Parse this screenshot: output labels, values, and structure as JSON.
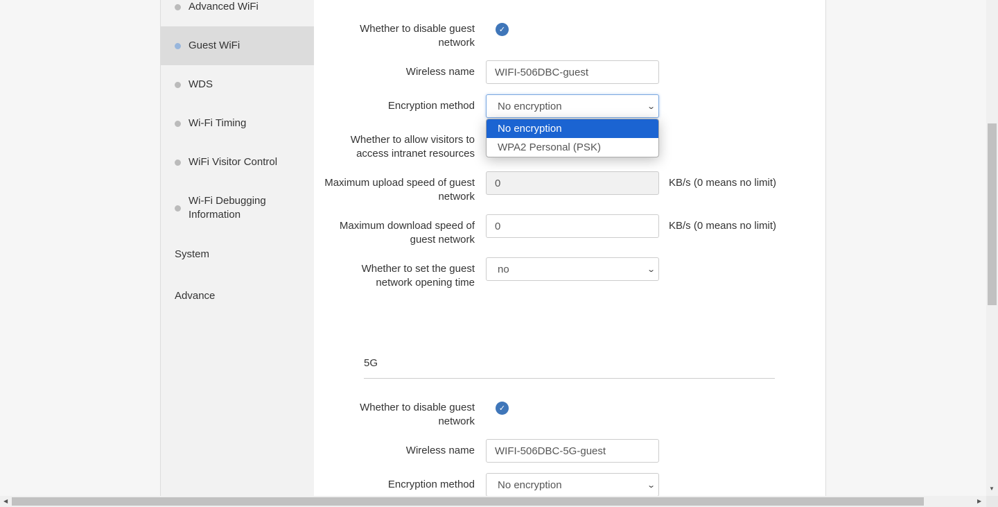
{
  "sidebar": {
    "items": [
      {
        "label": "Advanced WiFi",
        "active": false
      },
      {
        "label": "Guest WiFi",
        "active": true
      },
      {
        "label": "WDS",
        "active": false
      },
      {
        "label": "Wi-Fi Timing",
        "active": false
      },
      {
        "label": "WiFi Visitor Control",
        "active": false
      },
      {
        "label": "Wi-Fi Debugging Information",
        "active": false
      }
    ],
    "groups": [
      "System",
      "Advance"
    ]
  },
  "band24": {
    "disable_label": "Whether to disable guest network",
    "disable_checked": true,
    "name_label": "Wireless name",
    "name_value": "WIFI-506DBC-guest",
    "enc_label": "Encryption method",
    "enc_value": "No encryption",
    "enc_options": [
      "No encryption",
      "WPA2 Personal (PSK)"
    ],
    "intranet_label": "Whether to allow visitors to access intranet resources",
    "upload_label": "Maximum upload speed of guest network",
    "upload_value": "0",
    "upload_unit": "KB/s (0 means no limit)",
    "download_label": "Maximum download speed of guest network",
    "download_value": "0",
    "download_unit": "KB/s (0 means no limit)",
    "time_label": "Whether to set the guest network opening time",
    "time_value": "no"
  },
  "band5": {
    "title": "5G",
    "disable_label": "Whether to disable guest network",
    "disable_checked": true,
    "name_label": "Wireless name",
    "name_value": "WIFI-506DBC-5G-guest",
    "enc_label": "Encryption method",
    "enc_value": "No encryption"
  },
  "colors": {
    "accent": "#3f76b9",
    "highlight": "#1b64d2"
  }
}
